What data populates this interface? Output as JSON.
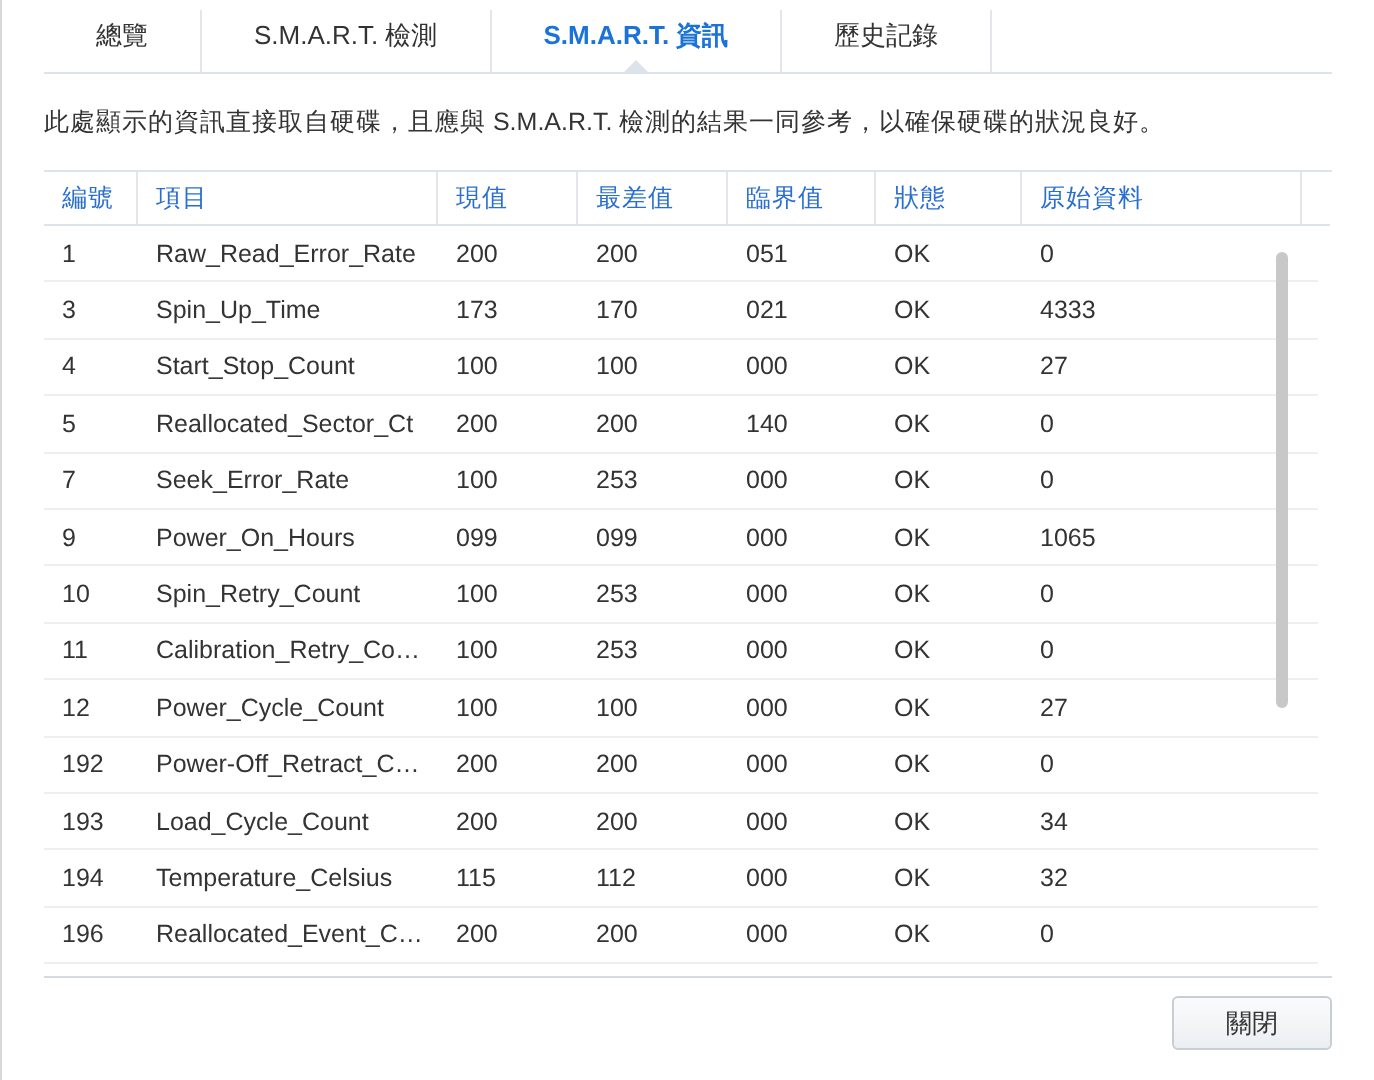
{
  "tabs": [
    {
      "label": "總覽",
      "selected": false
    },
    {
      "label": "S.M.A.R.T. 檢測",
      "selected": false
    },
    {
      "label": "S.M.A.R.T. 資訊",
      "selected": true
    },
    {
      "label": "歷史記錄",
      "selected": false
    }
  ],
  "description": "此處顯示的資訊直接取自硬碟，且應與 S.M.A.R.T. 檢測的結果一同參考，以確保硬碟的狀況良好。",
  "table": {
    "columns": [
      "編號",
      "項目",
      "現值",
      "最差值",
      "臨界值",
      "狀態",
      "原始資料"
    ],
    "rows": [
      [
        "1",
        "Raw_Read_Error_Rate",
        "200",
        "200",
        "051",
        "OK",
        "0"
      ],
      [
        "3",
        "Spin_Up_Time",
        "173",
        "170",
        "021",
        "OK",
        "4333"
      ],
      [
        "4",
        "Start_Stop_Count",
        "100",
        "100",
        "000",
        "OK",
        "27"
      ],
      [
        "5",
        "Reallocated_Sector_Ct",
        "200",
        "200",
        "140",
        "OK",
        "0"
      ],
      [
        "7",
        "Seek_Error_Rate",
        "100",
        "253",
        "000",
        "OK",
        "0"
      ],
      [
        "9",
        "Power_On_Hours",
        "099",
        "099",
        "000",
        "OK",
        "1065"
      ],
      [
        "10",
        "Spin_Retry_Count",
        "100",
        "253",
        "000",
        "OK",
        "0"
      ],
      [
        "11",
        "Calibration_Retry_Co…",
        "100",
        "253",
        "000",
        "OK",
        "0"
      ],
      [
        "12",
        "Power_Cycle_Count",
        "100",
        "100",
        "000",
        "OK",
        "27"
      ],
      [
        "192",
        "Power-Off_Retract_C…",
        "200",
        "200",
        "000",
        "OK",
        "0"
      ],
      [
        "193",
        "Load_Cycle_Count",
        "200",
        "200",
        "000",
        "OK",
        "34"
      ],
      [
        "194",
        "Temperature_Celsius",
        "115",
        "112",
        "000",
        "OK",
        "32"
      ],
      [
        "196",
        "Reallocated_Event_C…",
        "200",
        "200",
        "000",
        "OK",
        "0"
      ]
    ]
  },
  "buttons": [
    "關閉"
  ]
}
